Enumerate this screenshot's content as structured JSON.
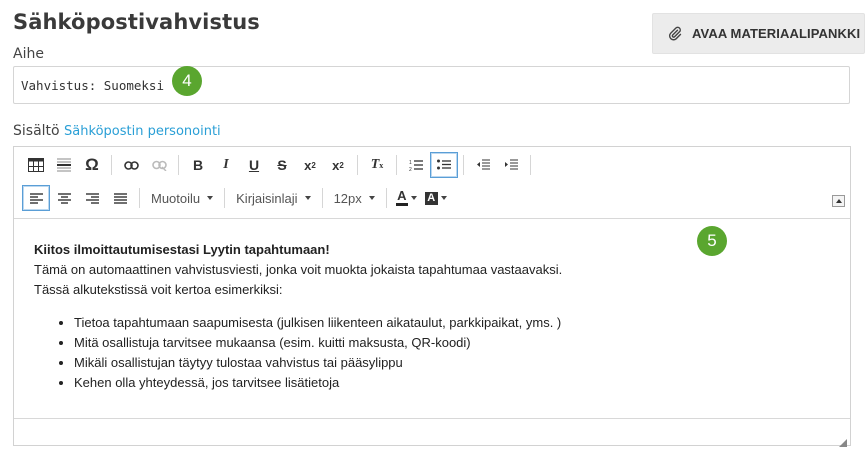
{
  "page": {
    "title": "Sähköpostivahvistus",
    "open_bank_label": "AVAA MATERIAALIPANKKI",
    "open_bank_icon": "paperclip-icon"
  },
  "subject": {
    "label": "Aihe",
    "value": "Vahvistus: Suomeksi",
    "step": "4"
  },
  "content": {
    "label": "Sisältö",
    "personalize_link": "Sähköpostin personointi",
    "step": "5"
  },
  "toolbar": {
    "row1": [
      "table-icon",
      "horizontal-rule-icon",
      "special-character-icon",
      "link-icon",
      "unlink-icon",
      "bold-icon",
      "italic-icon",
      "underline-icon",
      "strikethrough-icon",
      "subscript-icon",
      "superscript-icon",
      "clear-formatting-icon",
      "numbered-list-icon",
      "bulleted-list-icon",
      "outdent-icon",
      "indent-icon"
    ],
    "row2": [
      "align-left-icon",
      "align-center-icon",
      "align-right-icon",
      "align-justify-icon",
      "text-color-icon",
      "background-color-icon"
    ],
    "format_select": "Muotoilu",
    "font_select": "Kirjaisinlaji",
    "size_select": "12px",
    "active": [
      "bulleted-list-icon",
      "align-left-icon"
    ]
  },
  "body": {
    "heading": "Kiitos ilmoittautumisestasi Lyytin tapahtumaan!",
    "line1": "Tämä on automaattinen vahvistusviesti, jonka voit muokta jokaista tapahtumaa vastaavaksi.",
    "line2": "Tässä alkutekstissä voit kertoa esimerkiksi:",
    "bullets": [
      "Tietoa tapahtumaan saapumisesta (julkisen liikenteen aikataulut, parkkipaikat, yms. )",
      "Mitä osallistuja tarvitsee mukaansa (esim. kuitti maksusta, QR-koodi)",
      "Mikäli osallistujan täytyy tulostaa vahvistus tai pääsylippu",
      "Kehen olla yhteydessä, jos tarvitsee lisätietoja"
    ]
  },
  "colors": {
    "accent_link": "#2a9fd6",
    "step_badge": "#5aa62f",
    "active_border": "#5a9ed6"
  }
}
